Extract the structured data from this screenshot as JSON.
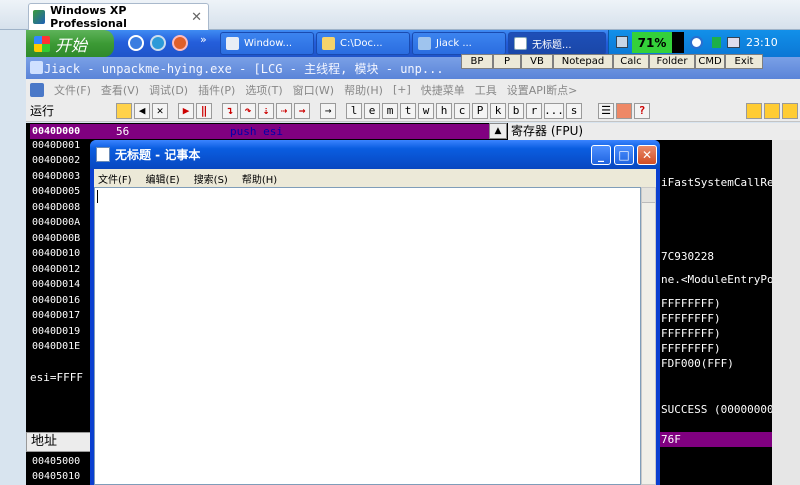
{
  "host": {
    "tab_title": "Windows XP Professional",
    "close": "✕"
  },
  "taskbar": {
    "start": "开始",
    "chevron": "»",
    "buttons": [
      "Window...",
      "C:\\Doc...",
      "Jiack ...",
      "无标题..."
    ],
    "battery": "71%",
    "clock": "23:10"
  },
  "jiack": {
    "title": "Jiack  - unpackme-hying.exe - [LCG - 主线程, 模块 - unp...",
    "quick_buttons": [
      "BP",
      "P",
      "VB",
      "Notepad",
      "Calc",
      "Folder",
      "CMD",
      "Exit"
    ],
    "menu": [
      "文件(F)",
      "查看(V)",
      "调试(D)",
      "插件(P)",
      "选项(T)",
      "窗口(W)",
      "帮助(H)",
      "[+]",
      "快捷菜单",
      "工具",
      "设置API断点>"
    ],
    "status": "运行",
    "toolbar_letters": [
      "l",
      "e",
      "m",
      "t",
      "w",
      "h",
      "c",
      "P",
      "k",
      "b",
      "r",
      "...",
      "s"
    ]
  },
  "disasm": {
    "rows": [
      "0040D000",
      "0040D001",
      "0040D002",
      "0040D003",
      "0040D005",
      "0040D008",
      "0040D00A",
      "0040D00B",
      "0040D010",
      "0040D012",
      "0040D014",
      "0040D016",
      "0040D017",
      "0040D019",
      "0040D01E"
    ],
    "selected_hex": "56",
    "selected_instr": "push esi",
    "info": "esi=FFFF"
  },
  "registers": {
    "header": "寄存器 (FPU)",
    "lines": [
      "iFastSystemCallRe",
      "7C930228",
      "ne.<ModuleEntryPoi",
      "FFFFFFFF)",
      "FFFFFFFF)",
      "FFFFFFFF)",
      "FFFFFFFF)",
      "FDF000(FFF)",
      "SUCCESS (00000000",
      "76F"
    ]
  },
  "dump": {
    "header": "地址",
    "rows": [
      "00405000",
      "00405010"
    ]
  },
  "notepad": {
    "title": "无标题 - 记事本",
    "menu": [
      "文件(F)",
      "编辑(E)",
      "搜索(S)",
      "帮助(H)"
    ],
    "content": ""
  },
  "colors": {
    "selection": "#800080",
    "xp_blue": "#245edb"
  }
}
